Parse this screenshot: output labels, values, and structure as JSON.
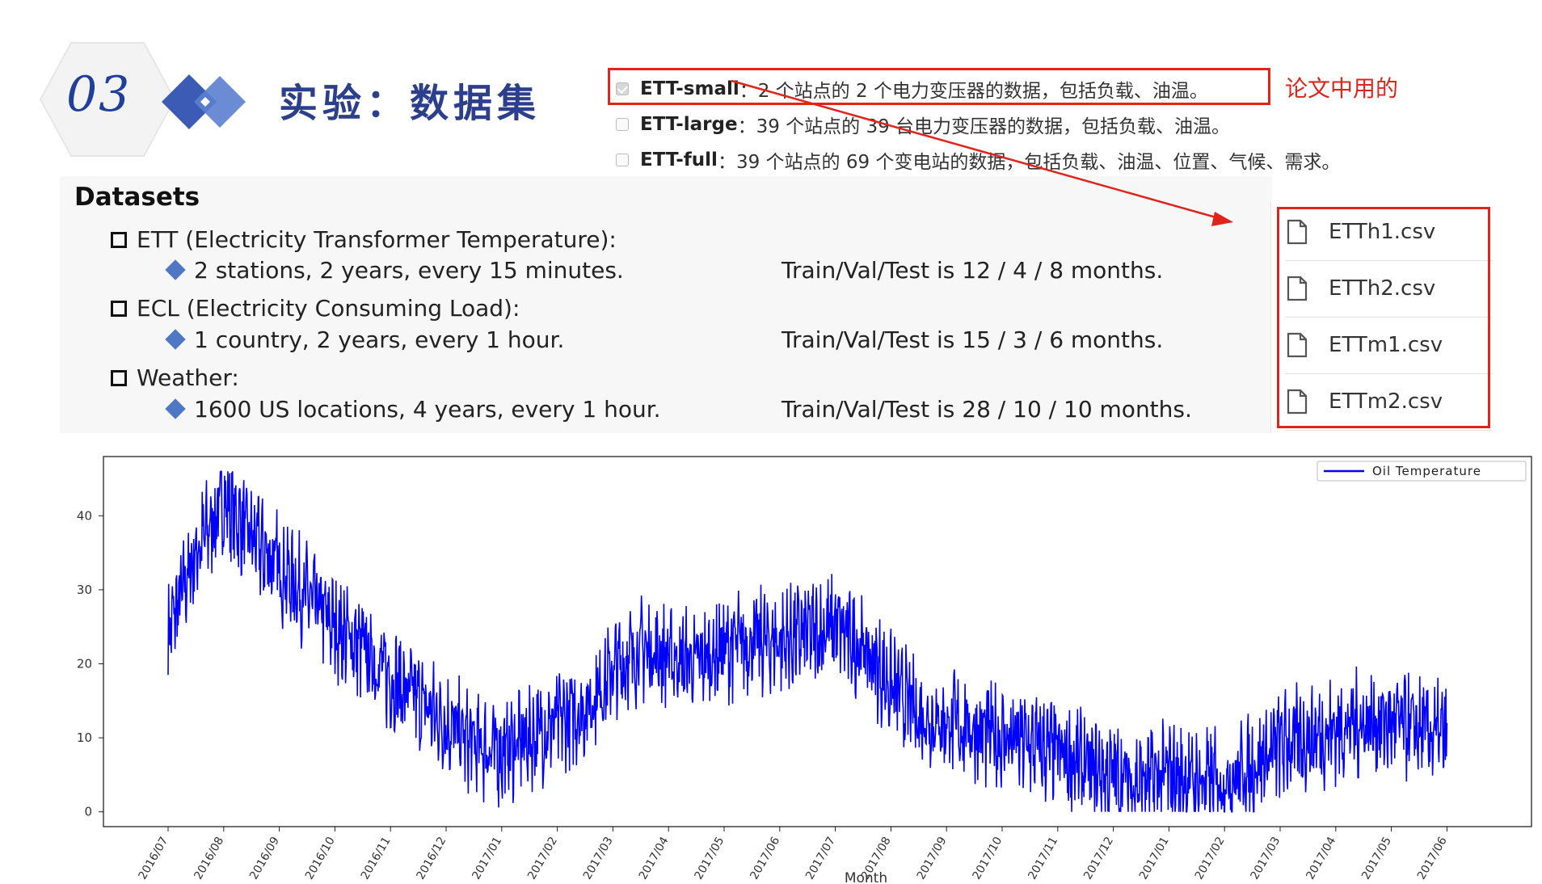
{
  "section": {
    "number": "03",
    "title": "实验：数据集"
  },
  "options": [
    {
      "name": "ETT-small",
      "desc": "：2 个站点的 2 个电力变压器的数据，包括负载、油温。",
      "checked": true
    },
    {
      "name": "ETT-large",
      "desc": "：39 个站点的 39 台电力变压器的数据，包括负载、油温。",
      "checked": false
    },
    {
      "name": "ETT-full",
      "desc": "：39 个站点的 69 个变电站的数据，包括负载、油温、位置、气候、需求。",
      "checked": false
    }
  ],
  "annotation": "论文中用的",
  "datasets": {
    "title": "Datasets",
    "items": [
      {
        "name": "ETT (Electricity Transformer Temperature):",
        "detail": "2 stations, 2 years, every 15 minutes.",
        "split": "Train/Val/Test is 12 / 4 / 8 months."
      },
      {
        "name": "ECL (Electricity Consuming Load):",
        "detail": "1 country, 2 years, every 1 hour.",
        "split": "Train/Val/Test is 15 / 3 / 6 months."
      },
      {
        "name": "Weather:",
        "detail": "1600 US locations, 4 years, every 1 hour.",
        "split": "Train/Val/Test is 28 / 10 / 10 months."
      }
    ]
  },
  "files": [
    "ETTh1.csv",
    "ETTh2.csv",
    "ETTm1.csv",
    "ETTm2.csv"
  ],
  "colors": {
    "accent": "#2b3f8c",
    "highlight": "#e0241b",
    "series": "#0000ff",
    "bullet": "#4f78c4"
  },
  "chart_data": {
    "type": "line",
    "title": "",
    "xlabel": "Month",
    "ylabel": "",
    "ylim": [
      -2,
      48
    ],
    "yticks": [
      0,
      10,
      20,
      30,
      40
    ],
    "legend_position": "top-right",
    "categories": [
      "2016/07",
      "2016/08",
      "2016/09",
      "2016/10",
      "2016/11",
      "2016/12",
      "2017/01",
      "2017/02",
      "2017/03",
      "2017/04",
      "2017/05",
      "2017/06",
      "2017/07",
      "2017/08",
      "2017/09",
      "2017/10",
      "2017/11",
      "2017/12",
      "2017/01",
      "2017/02",
      "2017/03",
      "2017/04",
      "2017/05",
      "2017/06"
    ],
    "x": [
      0.0,
      0.5,
      1.0,
      1.5,
      2.0,
      2.5,
      3.0,
      3.5,
      4.0,
      4.5,
      5.0,
      5.5,
      6.0,
      6.5,
      7.0,
      7.5,
      8.0,
      8.5,
      9.0,
      9.5,
      10.0,
      10.5,
      11.0,
      11.5,
      12.0,
      12.5,
      13.0,
      13.5,
      14.0,
      14.5,
      15.0,
      15.5,
      16.0,
      16.5,
      17.0,
      17.5,
      18.0,
      18.5,
      19.0,
      19.5,
      20.0,
      20.5,
      21.0,
      21.5,
      22.0,
      22.5,
      23.0,
      23.5
    ],
    "series": [
      {
        "name": "Oil Temperature",
        "values": [
          24,
          35,
          42,
          37,
          33,
          29,
          25,
          22,
          18,
          15,
          12,
          9,
          8,
          10,
          12,
          14,
          19,
          22,
          21,
          20,
          22,
          23,
          23,
          24,
          25,
          22,
          17,
          13,
          12,
          11,
          10,
          9,
          8,
          6,
          5,
          4,
          5,
          4,
          4,
          6,
          9,
          10,
          11,
          12,
          12,
          11,
          10,
          9
        ]
      }
    ]
  }
}
